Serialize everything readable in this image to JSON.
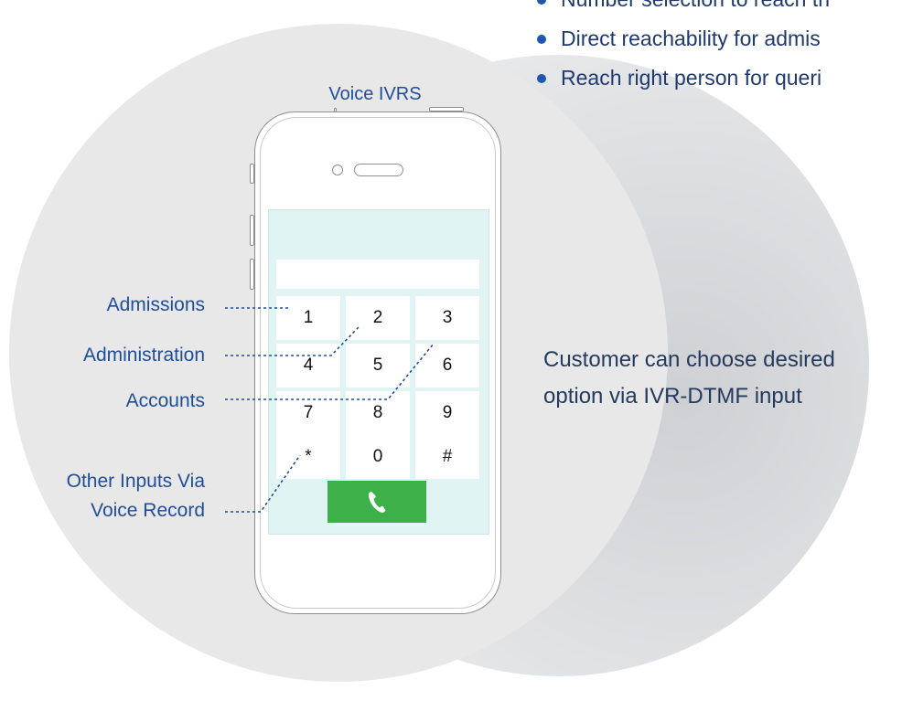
{
  "bullets": [
    "Number selection to reach th",
    "Direct reachability for admis",
    "Reach right person for queri"
  ],
  "title": "Voice IVRS",
  "keypad": [
    "1",
    "2",
    "3",
    "4",
    "5",
    "6",
    "7",
    "8",
    "9",
    "*",
    "0",
    "#"
  ],
  "labels": {
    "admissions": "Admissions",
    "administration": "Administration",
    "accounts": "Accounts",
    "other_line1": "Other Inputs Via",
    "other_line2": "Voice Record"
  },
  "side_text": {
    "line1": "Customer can choose desired",
    "line2": "option via IVR-DTMF input"
  },
  "icons": {
    "call": "phone-handset-icon"
  },
  "colors": {
    "accent": "#1f4d9a",
    "call_button": "#3db04a",
    "screen": "#e1f4f4"
  }
}
